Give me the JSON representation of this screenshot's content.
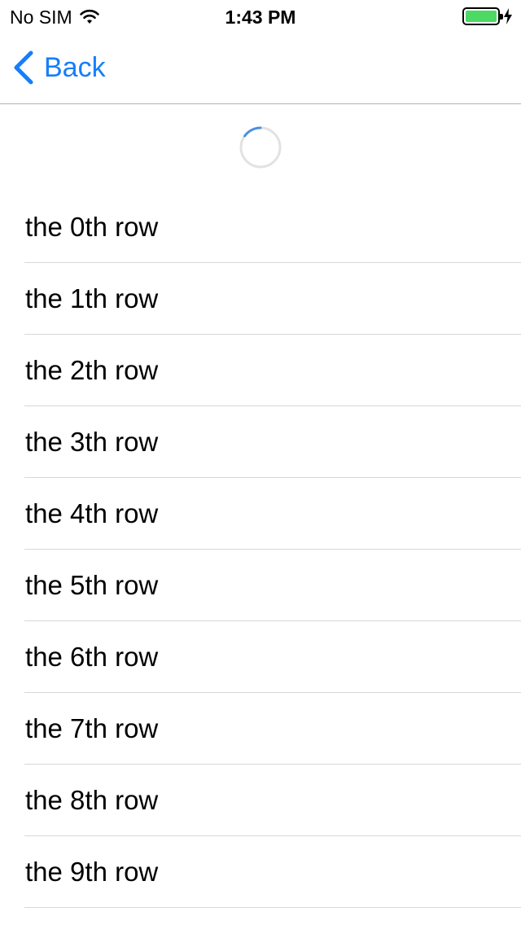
{
  "status_bar": {
    "carrier": "No SIM",
    "time": "1:43 PM",
    "wifi_icon": "wifi-icon",
    "battery_icon": "battery-icon",
    "battery_level": 1.0,
    "battery_color": "#4cd964",
    "charging_icon": "lightning-bolt-icon"
  },
  "nav": {
    "back_label": "Back",
    "back_icon": "chevron-left-icon",
    "tint_color": "#157efb"
  },
  "refresh": {
    "spinner_icon": "activity-spinner-icon",
    "accent_color": "#4a90e2"
  },
  "table": {
    "rows": [
      {
        "label": "the 0th row"
      },
      {
        "label": "the 1th row"
      },
      {
        "label": "the 2th row"
      },
      {
        "label": "the 3th row"
      },
      {
        "label": "the 4th row"
      },
      {
        "label": "the 5th row"
      },
      {
        "label": "the 6th row"
      },
      {
        "label": "the 7th row"
      },
      {
        "label": "the 8th row"
      },
      {
        "label": "the 9th row"
      }
    ]
  }
}
